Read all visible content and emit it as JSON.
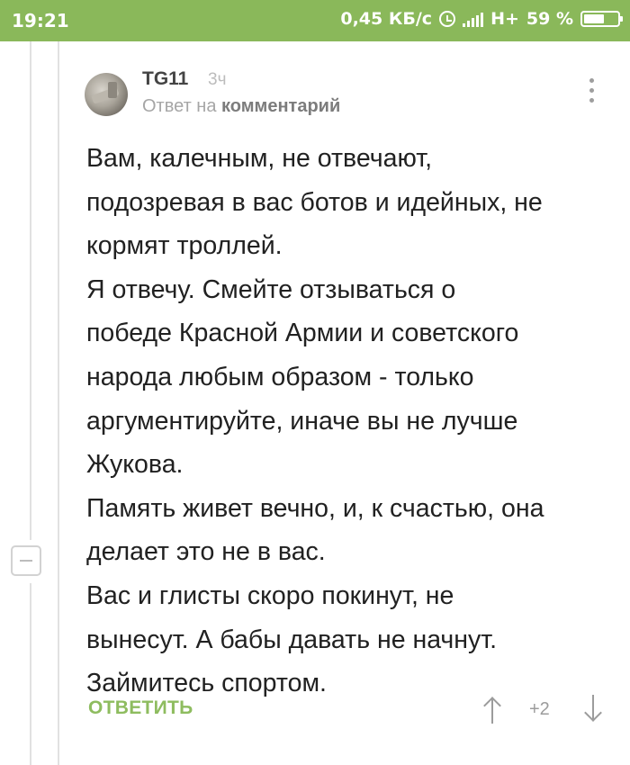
{
  "status_bar": {
    "time": "19:21",
    "network_speed": "0,45 КБ/с",
    "network_type": "H+",
    "battery": "59 %",
    "color": "#8ab85a"
  },
  "comment": {
    "author": "TG11",
    "time_ago": "3ч",
    "reply_prefix": "Ответ на",
    "reply_target": "комментарий",
    "avatar_icon": "avatar-photo",
    "lines": [
      "Вам, калечным, не отвечают,",
      "подозревая в вас ботов и идейных, не",
      "кормят троллей.",
      "Я отвечу. Смейте отзываться о",
      "победе Красной Армии и советского",
      "народа любым образом - только",
      "аргументируйте, иначе вы не лучше",
      "Жукова.",
      "Память живет вечно, и, к счастью, она",
      "делает это не в вас.",
      "Вас и глисты скоро покинут, не",
      "вынесут. А бабы давать не начнут.",
      "Займитесь спортом."
    ],
    "reply_label": "ОТВЕТИТЬ",
    "score": "+2",
    "accent_color": "#8ebc5f"
  }
}
